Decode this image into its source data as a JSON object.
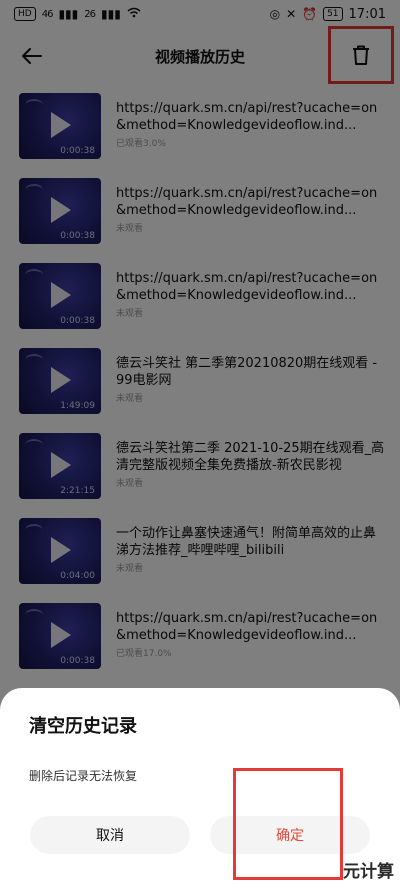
{
  "status_bar": {
    "left_badge": "HD",
    "signal1": "46",
    "signal2": "26",
    "battery": "51",
    "time": "17:01"
  },
  "header": {
    "title": "视频播放历史"
  },
  "icons": {
    "back": "arrow-left-icon",
    "delete": "trash-icon",
    "play": "play-icon"
  },
  "history": [
    {
      "duration": "0:00:38",
      "title": "https://quark.sm.cn/api/rest?ucache=on&method=Knowledgevideoflow.ind...",
      "status": "已观看3.0%"
    },
    {
      "duration": "0:00:38",
      "title": "https://quark.sm.cn/api/rest?ucache=on&method=Knowledgevideoflow.ind...",
      "status": "未观看"
    },
    {
      "duration": "0:00:38",
      "title": "https://quark.sm.cn/api/rest?ucache=on&method=Knowledgevideoflow.ind...",
      "status": "未观看"
    },
    {
      "duration": "1:49:09",
      "title": "德云斗笑社 第二季第20210820期在线观看 - 99电影网",
      "status": "未观看"
    },
    {
      "duration": "2:21:15",
      "title": "德云斗笑社第二季 2021-10-25期在线观看_高清完整版视频全集免费播放-新农民影视",
      "status": "未观看"
    },
    {
      "duration": "0:04:00",
      "title": "一个动作让鼻塞快速通气！附简单高效的止鼻涕方法推荐_哔哩哔哩_bilibili",
      "status": "未观看"
    },
    {
      "duration": "0:00:38",
      "title": "https://quark.sm.cn/api/rest?ucache=on&method=Knowledgevideoflow.ind...",
      "status": "已观看17.0%"
    }
  ],
  "dialog": {
    "title": "清空历史记录",
    "description": "删除后记录无法恢复",
    "cancel_label": "取消",
    "confirm_label": "确定"
  },
  "watermark": "元计算",
  "colors": {
    "accent_red": "#e24a3c",
    "highlight_outline": "#e53935"
  }
}
